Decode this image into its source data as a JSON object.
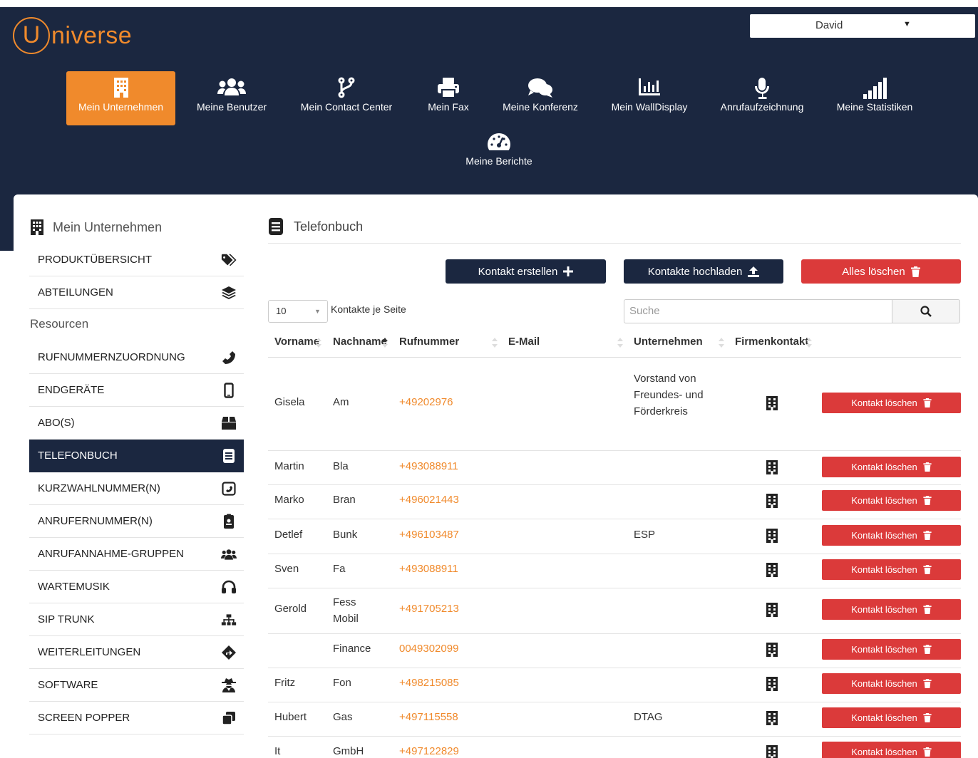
{
  "brand": {
    "logo_letter": "U",
    "logo_rest": "niverse",
    "accent": "#f08a2c",
    "navy": "#1b2740",
    "danger": "#db3a3a"
  },
  "user": {
    "name": "David"
  },
  "nav": [
    {
      "label": "Mein Unternehmen",
      "icon": "building-icon",
      "active": true
    },
    {
      "label": "Meine Benutzer",
      "icon": "users-icon"
    },
    {
      "label": "Mein Contact Center",
      "icon": "code-fork-icon"
    },
    {
      "label": "Mein Fax",
      "icon": "printer-icon"
    },
    {
      "label": "Meine Konferenz",
      "icon": "comments-icon"
    },
    {
      "label": "Mein WallDisplay",
      "icon": "bar-chart-icon"
    },
    {
      "label": "Anrufaufzeichnung",
      "icon": "microphone-icon"
    },
    {
      "label": "Meine Statistiken",
      "icon": "signal-icon"
    },
    {
      "label": "Meine Berichte",
      "icon": "dashboard-icon"
    }
  ],
  "sidebar": {
    "title": "Mein Unternehmen",
    "group_label": "Resourcen",
    "items": [
      {
        "label": "PRODUKTÜBERSICHT",
        "icon": "tags-icon"
      },
      {
        "label": "ABTEILUNGEN",
        "icon": "layers-icon"
      },
      {
        "label": "RUFNUMMERNZUORDNUNG",
        "icon": "phone-icon"
      },
      {
        "label": "ENDGERÄTE",
        "icon": "mobile-icon"
      },
      {
        "label": "ABO(S)",
        "icon": "box-icon"
      },
      {
        "label": "TELEFONBUCH",
        "icon": "book-icon",
        "active": true
      },
      {
        "label": "KURZWAHLNUMMER(N)",
        "icon": "phone-square-icon"
      },
      {
        "label": "ANRUFERNUMMER(N)",
        "icon": "id-badge-icon"
      },
      {
        "label": "ANRUFANNAHME-GRUPPEN",
        "icon": "group-icon"
      },
      {
        "label": "WARTEMUSIK",
        "icon": "headphones-icon"
      },
      {
        "label": "SIP TRUNK",
        "icon": "sitemap-icon"
      },
      {
        "label": "WEITERLEITUNGEN",
        "icon": "direction-icon"
      },
      {
        "label": "SOFTWARE",
        "icon": "user-secret-icon"
      },
      {
        "label": "SCREEN POPPER",
        "icon": "clone-icon"
      }
    ]
  },
  "main": {
    "title": "Telefonbuch",
    "buttons": {
      "create": "Kontakt erstellen",
      "upload": "Kontakte hochladen",
      "delete_all": "Alles löschen"
    },
    "per_page_value": "10",
    "per_page_label": "Kontakte je Seite",
    "search_placeholder": "Suche",
    "columns": [
      "Vorname",
      "Nachname",
      "Rufnummer",
      "E-Mail",
      "Unternehmen",
      "Firmenkontakt"
    ],
    "delete_label": "Kontakt löschen",
    "rows": [
      {
        "first": "Gisela",
        "last": "Am",
        "phone": "+49202976",
        "email": "",
        "company": "Vorstand von Freundes- und Förderkreis"
      },
      {
        "first": "Martin",
        "last": "Bla",
        "phone": "+493088911",
        "email": "",
        "company": ""
      },
      {
        "first": "Marko",
        "last": "Bran",
        "phone": "+496021443",
        "email": "",
        "company": ""
      },
      {
        "first": "Detlef",
        "last": "Bunk",
        "phone": "+496103487",
        "email": "",
        "company": "ESP"
      },
      {
        "first": "Sven",
        "last": "Fa",
        "phone": "+493088911",
        "email": "",
        "company": ""
      },
      {
        "first": "Gerold",
        "last": "Fess Mobil",
        "phone": "+491705213",
        "email": "",
        "company": ""
      },
      {
        "first": "",
        "last": "Finance",
        "phone": "0049302099",
        "email": "",
        "company": ""
      },
      {
        "first": "Fritz",
        "last": "Fon",
        "phone": "+498215085",
        "email": "",
        "company": ""
      },
      {
        "first": "Hubert",
        "last": "Gas",
        "phone": "+497115558",
        "email": "",
        "company": "DTAG"
      },
      {
        "first": "It",
        "last": "GmbH",
        "phone": "+497122829",
        "email": "",
        "company": ""
      }
    ]
  }
}
